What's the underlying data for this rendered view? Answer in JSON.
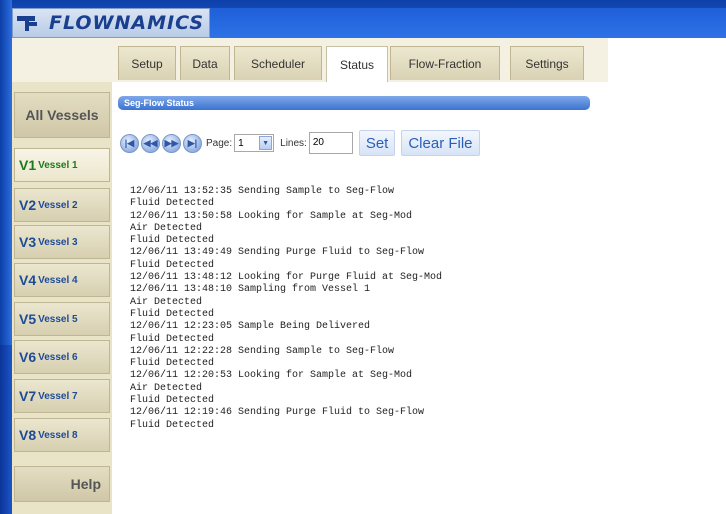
{
  "brand": {
    "name": "FLOWNAMICS"
  },
  "tabs": [
    {
      "label": "Setup"
    },
    {
      "label": "Data"
    },
    {
      "label": "Scheduler"
    },
    {
      "label": "Status"
    },
    {
      "label": "Flow-Fraction"
    },
    {
      "label": "Settings"
    }
  ],
  "active_tab": "Status",
  "sidebar": {
    "all_label": "All Vessels",
    "help_label": "Help",
    "vessels": [
      {
        "id": "V1",
        "label": "Vessel 1"
      },
      {
        "id": "V2",
        "label": "Vessel 2"
      },
      {
        "id": "V3",
        "label": "Vessel 3"
      },
      {
        "id": "V4",
        "label": "Vessel 4"
      },
      {
        "id": "V5",
        "label": "Vessel 5"
      },
      {
        "id": "V6",
        "label": "Vessel 6"
      },
      {
        "id": "V7",
        "label": "Vessel 7"
      },
      {
        "id": "V8",
        "label": "Vessel 8"
      }
    ]
  },
  "status_panel": {
    "title": "Seg-Flow Status",
    "page_label": "Page:",
    "page_value": "1",
    "lines_label": "Lines:",
    "lines_value": "20",
    "set_label": "Set",
    "clear_label": "Clear File"
  },
  "log": [
    "12/06/11 13:52:35 Sending Sample to Seg-Flow",
    "Fluid Detected",
    "12/06/11 13:50:58 Looking for Sample at Seg-Mod",
    "Air Detected",
    "Fluid Detected",
    "12/06/11 13:49:49 Sending Purge Fluid to Seg-Flow",
    "Fluid Detected",
    "12/06/11 13:48:12 Looking for Purge Fluid at Seg-Mod",
    "12/06/11 13:48:10 Sampling from Vessel 1",
    "Air Detected",
    "Fluid Detected",
    "12/06/11 12:23:05 Sample Being Delivered",
    "Fluid Detected",
    "12/06/11 12:22:28 Sending Sample to Seg-Flow",
    "Fluid Detected",
    "12/06/11 12:20:53 Looking for Sample at Seg-Mod",
    "Air Detected",
    "Fluid Detected",
    "12/06/11 12:19:46 Sending Purge Fluid to Seg-Flow",
    "Fluid Detected"
  ],
  "colors": {
    "frame_blue": "#1b56c8",
    "vessel_green": "#1b7a1b",
    "vessel_blue": "#1d4b97",
    "button_text": "#2a5fb6"
  }
}
